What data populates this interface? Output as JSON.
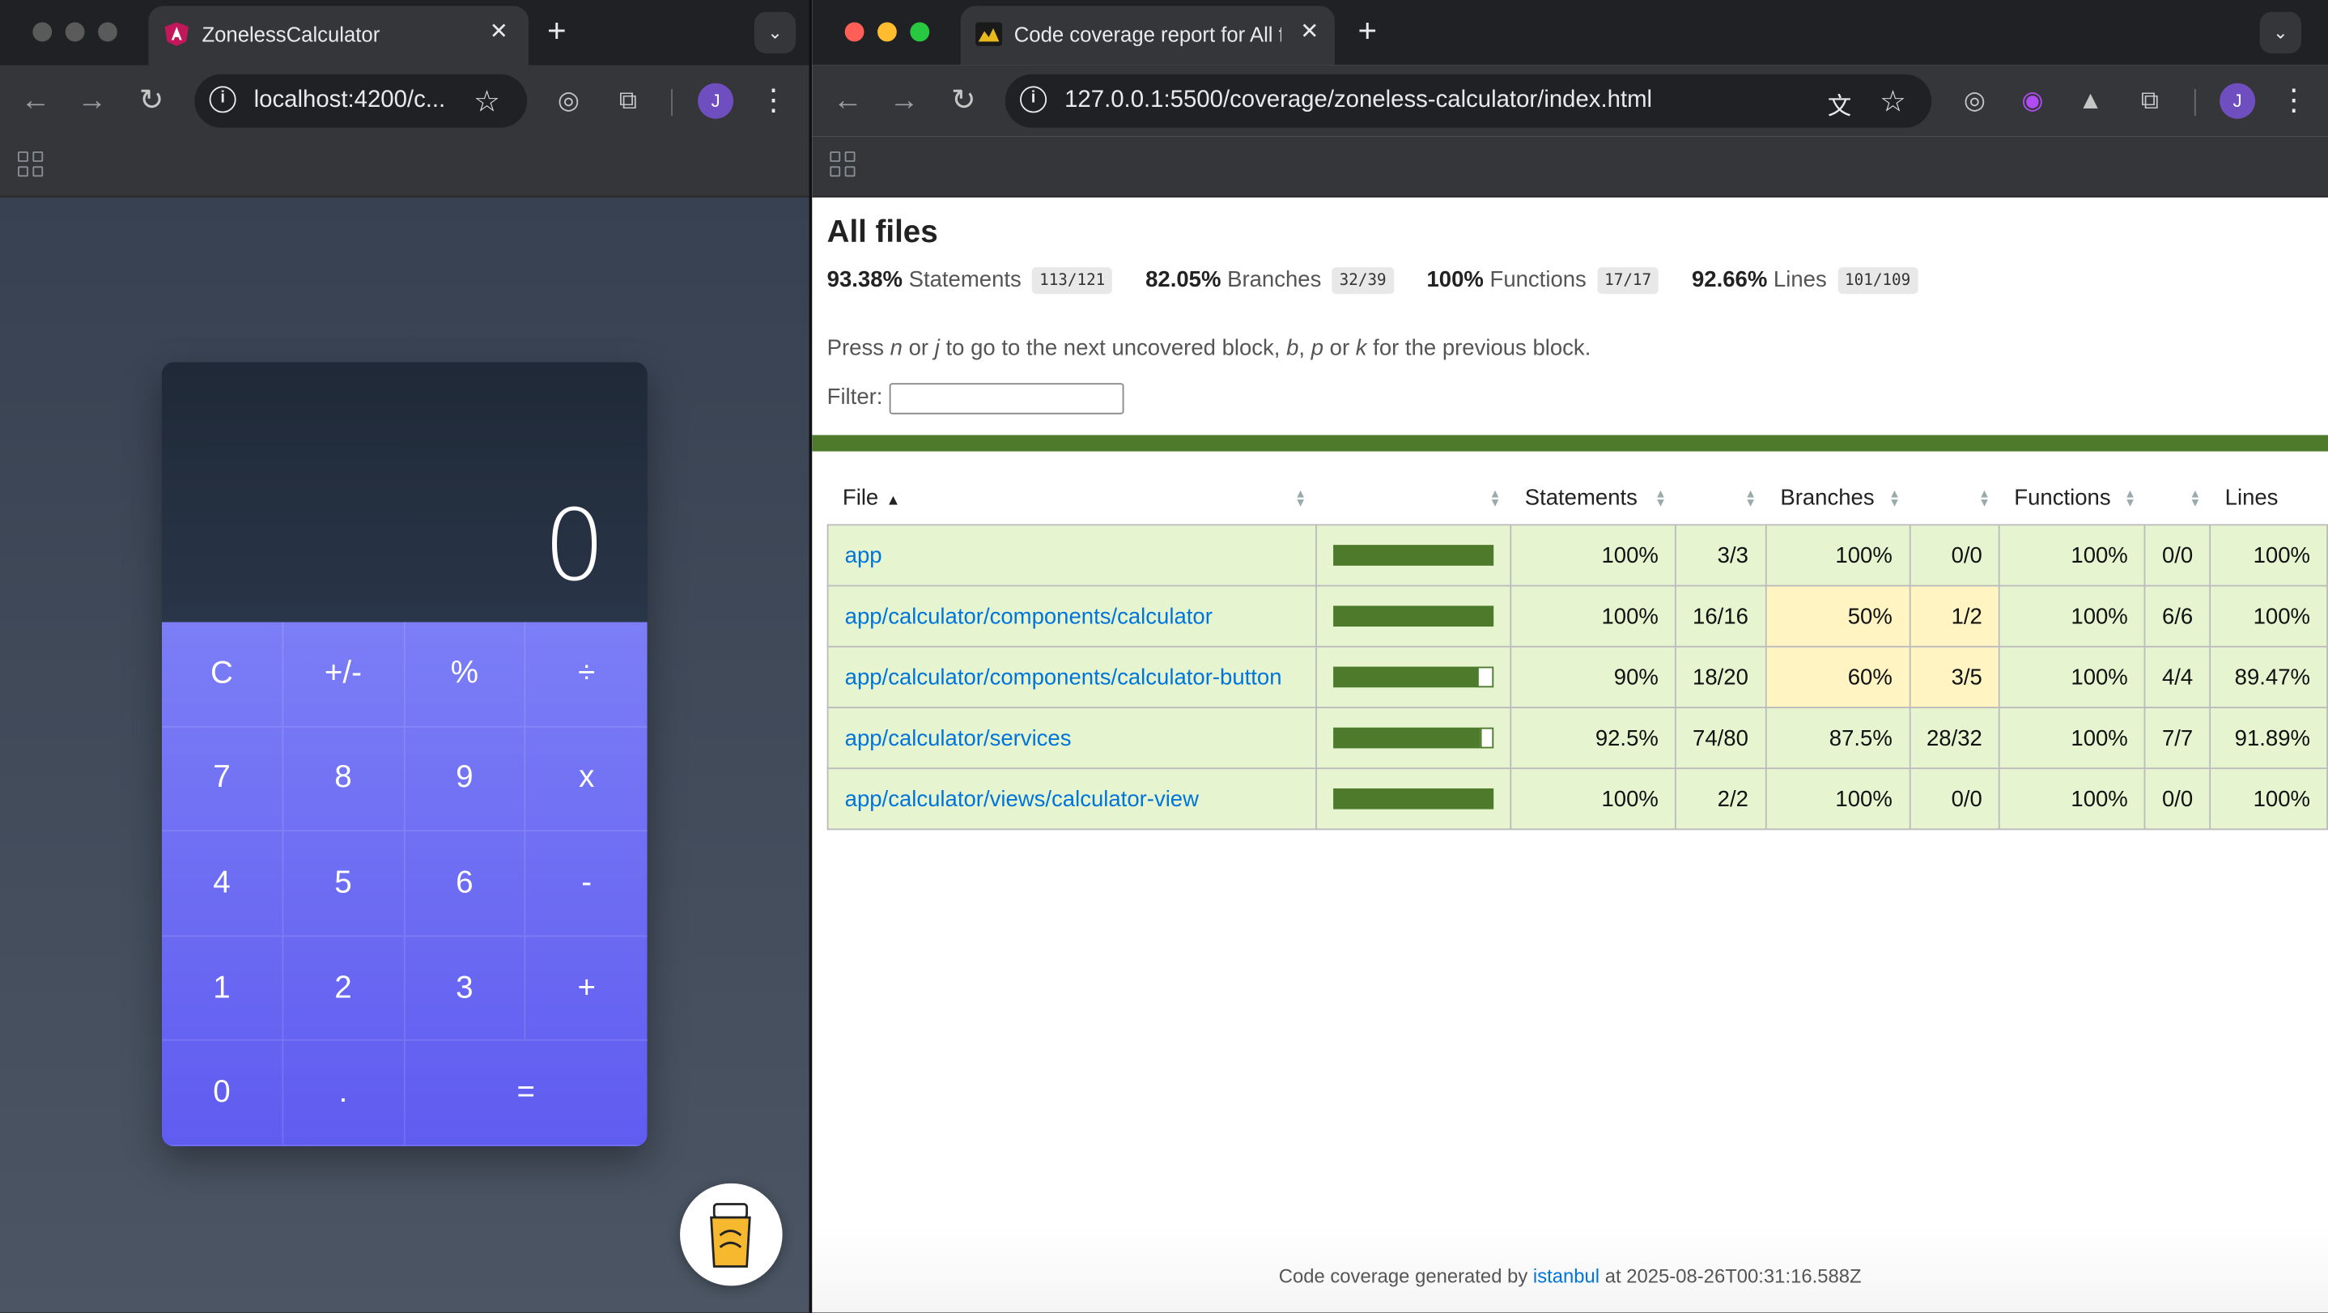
{
  "left_window": {
    "tab_title": "ZonelessCalculator",
    "url": "localhost:4200/c...",
    "avatar_letter": "J",
    "calculator": {
      "display": "0",
      "keys": [
        "C",
        "+/-",
        "%",
        "÷",
        "7",
        "8",
        "9",
        "x",
        "4",
        "5",
        "6",
        "-",
        "1",
        "2",
        "3",
        "+",
        "0",
        ".",
        "="
      ]
    }
  },
  "right_window": {
    "tab_title": "Code coverage report for All f",
    "url": "127.0.0.1:5500/coverage/zoneless-calculator/index.html",
    "avatar_letter": "J",
    "report": {
      "title": "All files",
      "summary": [
        {
          "pct": "93.38%",
          "label": "Statements",
          "fraction": "113/121"
        },
        {
          "pct": "82.05%",
          "label": "Branches",
          "fraction": "32/39"
        },
        {
          "pct": "100%",
          "label": "Functions",
          "fraction": "17/17"
        },
        {
          "pct": "92.66%",
          "label": "Lines",
          "fraction": "101/109"
        }
      ],
      "hint_parts": [
        "Press ",
        "n",
        " or ",
        "j",
        " to go to the next uncovered block, ",
        "b",
        ", ",
        "p",
        " or ",
        "k",
        " for the previous block."
      ],
      "filter_label": "Filter:",
      "filter_value": "",
      "columns": {
        "file": "File",
        "statements": "Statements",
        "branches": "Branches",
        "functions": "Functions",
        "lines": "Lines"
      },
      "rows": [
        {
          "file": "app",
          "stmt_pct": "100%",
          "stmt": "3/3",
          "br_pct": "100%",
          "br": "0/0",
          "fn_pct": "100%",
          "fn": "0/0",
          "ln_pct": "100%",
          "coverage": 1.0,
          "br_level": "high"
        },
        {
          "file": "app/calculator/components/calculator",
          "stmt_pct": "100%",
          "stmt": "16/16",
          "br_pct": "50%",
          "br": "1/2",
          "fn_pct": "100%",
          "fn": "6/6",
          "ln_pct": "100%",
          "coverage": 1.0,
          "br_level": "medium"
        },
        {
          "file": "app/calculator/components/calculator-button",
          "stmt_pct": "90%",
          "stmt": "18/20",
          "br_pct": "60%",
          "br": "3/5",
          "fn_pct": "100%",
          "fn": "4/4",
          "ln_pct": "89.47%",
          "coverage": 0.9,
          "br_level": "medium"
        },
        {
          "file": "app/calculator/services",
          "stmt_pct": "92.5%",
          "stmt": "74/80",
          "br_pct": "87.5%",
          "br": "28/32",
          "fn_pct": "100%",
          "fn": "7/7",
          "ln_pct": "91.89%",
          "coverage": 0.925,
          "br_level": "high"
        },
        {
          "file": "app/calculator/views/calculator-view",
          "stmt_pct": "100%",
          "stmt": "2/2",
          "br_pct": "100%",
          "br": "0/0",
          "fn_pct": "100%",
          "fn": "0/0",
          "ln_pct": "100%",
          "coverage": 1.0,
          "br_level": "high"
        }
      ],
      "footer": {
        "prefix": "Code coverage generated by ",
        "link": "istanbul",
        "suffix": " at 2025-08-26T00:31:16.588Z"
      }
    }
  },
  "colors": {
    "coverage_high": "#4d7b2b",
    "row_high_bg": "#e6f5d0",
    "row_medium_bg": "#fff4c2",
    "calc_keys": "#6366f1",
    "link": "#0074d9"
  }
}
